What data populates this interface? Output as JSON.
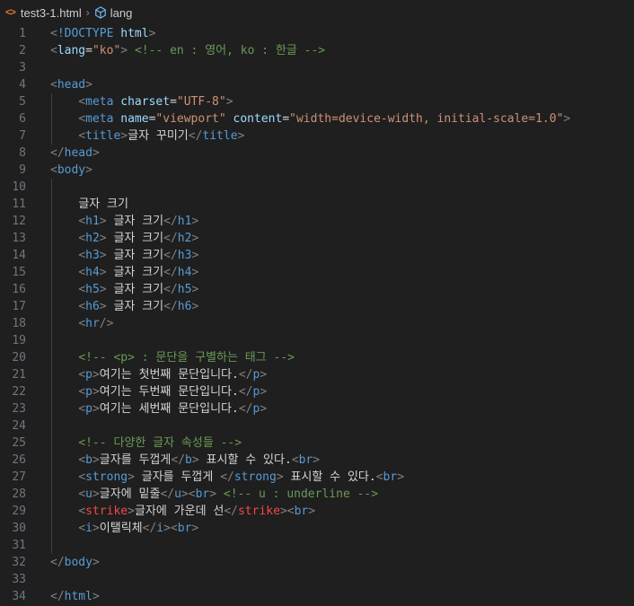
{
  "breadcrumb": {
    "file": "test3-1.html",
    "symbol": "lang"
  },
  "lines": [
    {
      "n": "1",
      "indent": 0,
      "tokens": [
        [
          "p",
          "<"
        ],
        [
          "kw",
          "!DOCTYPE"
        ],
        [
          "x",
          " "
        ],
        [
          "a",
          "html"
        ],
        [
          "p",
          ">"
        ]
      ]
    },
    {
      "n": "2",
      "indent": 0,
      "tokens": [
        [
          "p",
          "<"
        ],
        [
          "a",
          "lang"
        ],
        [
          "x",
          "="
        ],
        [
          "s",
          "\"ko\""
        ],
        [
          "p",
          ">"
        ],
        [
          "x",
          " "
        ],
        [
          "c",
          "<!-- en : 영어, ko : 한글 -->"
        ]
      ]
    },
    {
      "n": "3",
      "indent": 0,
      "tokens": []
    },
    {
      "n": "4",
      "indent": 0,
      "tokens": [
        [
          "p",
          "<"
        ],
        [
          "t",
          "head"
        ],
        [
          "p",
          ">"
        ]
      ]
    },
    {
      "n": "5",
      "indent": 1,
      "tokens": [
        [
          "p",
          "<"
        ],
        [
          "t",
          "meta"
        ],
        [
          "x",
          " "
        ],
        [
          "a",
          "charset"
        ],
        [
          "x",
          "="
        ],
        [
          "s",
          "\"UTF-8\""
        ],
        [
          "p",
          ">"
        ]
      ]
    },
    {
      "n": "6",
      "indent": 1,
      "tokens": [
        [
          "p",
          "<"
        ],
        [
          "t",
          "meta"
        ],
        [
          "x",
          " "
        ],
        [
          "a",
          "name"
        ],
        [
          "x",
          "="
        ],
        [
          "s",
          "\"viewport\""
        ],
        [
          "x",
          " "
        ],
        [
          "a",
          "content"
        ],
        [
          "x",
          "="
        ],
        [
          "s",
          "\"width=device-width, initial-scale=1.0\""
        ],
        [
          "p",
          ">"
        ]
      ]
    },
    {
      "n": "7",
      "indent": 1,
      "tokens": [
        [
          "p",
          "<"
        ],
        [
          "t",
          "title"
        ],
        [
          "p",
          ">"
        ],
        [
          "x",
          "글자 꾸미기"
        ],
        [
          "p",
          "</"
        ],
        [
          "t",
          "title"
        ],
        [
          "p",
          ">"
        ]
      ]
    },
    {
      "n": "8",
      "indent": 0,
      "tokens": [
        [
          "p",
          "</"
        ],
        [
          "t",
          "head"
        ],
        [
          "p",
          ">"
        ]
      ]
    },
    {
      "n": "9",
      "indent": 0,
      "tokens": [
        [
          "p",
          "<"
        ],
        [
          "t",
          "body"
        ],
        [
          "p",
          ">"
        ]
      ]
    },
    {
      "n": "10",
      "indent": 0,
      "tokens": []
    },
    {
      "n": "11",
      "indent": 1,
      "tokens": [
        [
          "x",
          "글자 크기"
        ]
      ]
    },
    {
      "n": "12",
      "indent": 1,
      "tokens": [
        [
          "p",
          "<"
        ],
        [
          "t",
          "h1"
        ],
        [
          "p",
          ">"
        ],
        [
          "x",
          " 글자 크기"
        ],
        [
          "p",
          "</"
        ],
        [
          "t",
          "h1"
        ],
        [
          "p",
          ">"
        ]
      ]
    },
    {
      "n": "13",
      "indent": 1,
      "tokens": [
        [
          "p",
          "<"
        ],
        [
          "t",
          "h2"
        ],
        [
          "p",
          ">"
        ],
        [
          "x",
          " 글자 크기"
        ],
        [
          "p",
          "</"
        ],
        [
          "t",
          "h2"
        ],
        [
          "p",
          ">"
        ]
      ]
    },
    {
      "n": "14",
      "indent": 1,
      "tokens": [
        [
          "p",
          "<"
        ],
        [
          "t",
          "h3"
        ],
        [
          "p",
          ">"
        ],
        [
          "x",
          " 글자 크기"
        ],
        [
          "p",
          "</"
        ],
        [
          "t",
          "h3"
        ],
        [
          "p",
          ">"
        ]
      ]
    },
    {
      "n": "15",
      "indent": 1,
      "tokens": [
        [
          "p",
          "<"
        ],
        [
          "t",
          "h4"
        ],
        [
          "p",
          ">"
        ],
        [
          "x",
          " 글자 크기"
        ],
        [
          "p",
          "</"
        ],
        [
          "t",
          "h4"
        ],
        [
          "p",
          ">"
        ]
      ]
    },
    {
      "n": "16",
      "indent": 1,
      "tokens": [
        [
          "p",
          "<"
        ],
        [
          "t",
          "h5"
        ],
        [
          "p",
          ">"
        ],
        [
          "x",
          " 글자 크기"
        ],
        [
          "p",
          "</"
        ],
        [
          "t",
          "h5"
        ],
        [
          "p",
          ">"
        ]
      ]
    },
    {
      "n": "17",
      "indent": 1,
      "tokens": [
        [
          "p",
          "<"
        ],
        [
          "t",
          "h6"
        ],
        [
          "p",
          ">"
        ],
        [
          "x",
          " 글자 크기"
        ],
        [
          "p",
          "</"
        ],
        [
          "t",
          "h6"
        ],
        [
          "p",
          ">"
        ]
      ]
    },
    {
      "n": "18",
      "indent": 1,
      "tokens": [
        [
          "p",
          "<"
        ],
        [
          "t",
          "hr"
        ],
        [
          "p",
          "/>"
        ]
      ]
    },
    {
      "n": "19",
      "indent": 0,
      "tokens": []
    },
    {
      "n": "20",
      "indent": 1,
      "tokens": [
        [
          "c",
          "<!-- <p> : 문단을 구별하는 태그 -->"
        ]
      ]
    },
    {
      "n": "21",
      "indent": 1,
      "tokens": [
        [
          "p",
          "<"
        ],
        [
          "t",
          "p"
        ],
        [
          "p",
          ">"
        ],
        [
          "x",
          "여기는 첫번째 문단입니다."
        ],
        [
          "p",
          "</"
        ],
        [
          "t",
          "p"
        ],
        [
          "p",
          ">"
        ]
      ]
    },
    {
      "n": "22",
      "indent": 1,
      "tokens": [
        [
          "p",
          "<"
        ],
        [
          "t",
          "p"
        ],
        [
          "p",
          ">"
        ],
        [
          "x",
          "여기는 두번째 문단입니다."
        ],
        [
          "p",
          "</"
        ],
        [
          "t",
          "p"
        ],
        [
          "p",
          ">"
        ]
      ]
    },
    {
      "n": "23",
      "indent": 1,
      "tokens": [
        [
          "p",
          "<"
        ],
        [
          "t",
          "p"
        ],
        [
          "p",
          ">"
        ],
        [
          "x",
          "여기는 세번째 문단입니다."
        ],
        [
          "p",
          "</"
        ],
        [
          "t",
          "p"
        ],
        [
          "p",
          ">"
        ]
      ]
    },
    {
      "n": "24",
      "indent": 0,
      "tokens": []
    },
    {
      "n": "25",
      "indent": 1,
      "tokens": [
        [
          "c",
          "<!-- 다양한 글자 속성들 -->"
        ]
      ]
    },
    {
      "n": "26",
      "indent": 1,
      "tokens": [
        [
          "p",
          "<"
        ],
        [
          "t",
          "b"
        ],
        [
          "p",
          ">"
        ],
        [
          "x",
          "글자를 두껍게"
        ],
        [
          "p",
          "</"
        ],
        [
          "t",
          "b"
        ],
        [
          "p",
          ">"
        ],
        [
          "x",
          " 표시할 수 있다."
        ],
        [
          "p",
          "<"
        ],
        [
          "t",
          "br"
        ],
        [
          "p",
          ">"
        ]
      ]
    },
    {
      "n": "27",
      "indent": 1,
      "tokens": [
        [
          "p",
          "<"
        ],
        [
          "t",
          "strong"
        ],
        [
          "p",
          ">"
        ],
        [
          "x",
          " 글자를 두껍게 "
        ],
        [
          "p",
          "</"
        ],
        [
          "t",
          "strong"
        ],
        [
          "p",
          ">"
        ],
        [
          "x",
          " 표시할 수 있다."
        ],
        [
          "p",
          "<"
        ],
        [
          "t",
          "br"
        ],
        [
          "p",
          ">"
        ]
      ]
    },
    {
      "n": "28",
      "indent": 1,
      "tokens": [
        [
          "p",
          "<"
        ],
        [
          "t",
          "u"
        ],
        [
          "p",
          ">"
        ],
        [
          "x",
          "글자에 밑줄"
        ],
        [
          "p",
          "</"
        ],
        [
          "t",
          "u"
        ],
        [
          "p",
          ">"
        ],
        [
          "p",
          "<"
        ],
        [
          "t",
          "br"
        ],
        [
          "p",
          ">"
        ],
        [
          "x",
          " "
        ],
        [
          "c",
          "<!-- u : underline -->"
        ]
      ]
    },
    {
      "n": "29",
      "indent": 1,
      "tokens": [
        [
          "p",
          "<"
        ],
        [
          "st",
          "strike"
        ],
        [
          "p",
          ">"
        ],
        [
          "x",
          "글자에 가운데 선"
        ],
        [
          "p",
          "</"
        ],
        [
          "st",
          "strike"
        ],
        [
          "p",
          ">"
        ],
        [
          "p",
          "<"
        ],
        [
          "t",
          "br"
        ],
        [
          "p",
          ">"
        ]
      ]
    },
    {
      "n": "30",
      "indent": 1,
      "tokens": [
        [
          "p",
          "<"
        ],
        [
          "t",
          "i"
        ],
        [
          "p",
          ">"
        ],
        [
          "x",
          "이탤릭체"
        ],
        [
          "p",
          "</"
        ],
        [
          "t",
          "i"
        ],
        [
          "p",
          ">"
        ],
        [
          "p",
          "<"
        ],
        [
          "t",
          "br"
        ],
        [
          "p",
          ">"
        ]
      ]
    },
    {
      "n": "31",
      "indent": 0,
      "tokens": []
    },
    {
      "n": "32",
      "indent": 0,
      "tokens": [
        [
          "p",
          "</"
        ],
        [
          "t",
          "body"
        ],
        [
          "p",
          ">"
        ]
      ]
    },
    {
      "n": "33",
      "indent": 0,
      "tokens": []
    },
    {
      "n": "34",
      "indent": 0,
      "tokens": [
        [
          "p",
          "</"
        ],
        [
          "t",
          "html"
        ],
        [
          "p",
          ">"
        ]
      ]
    }
  ]
}
